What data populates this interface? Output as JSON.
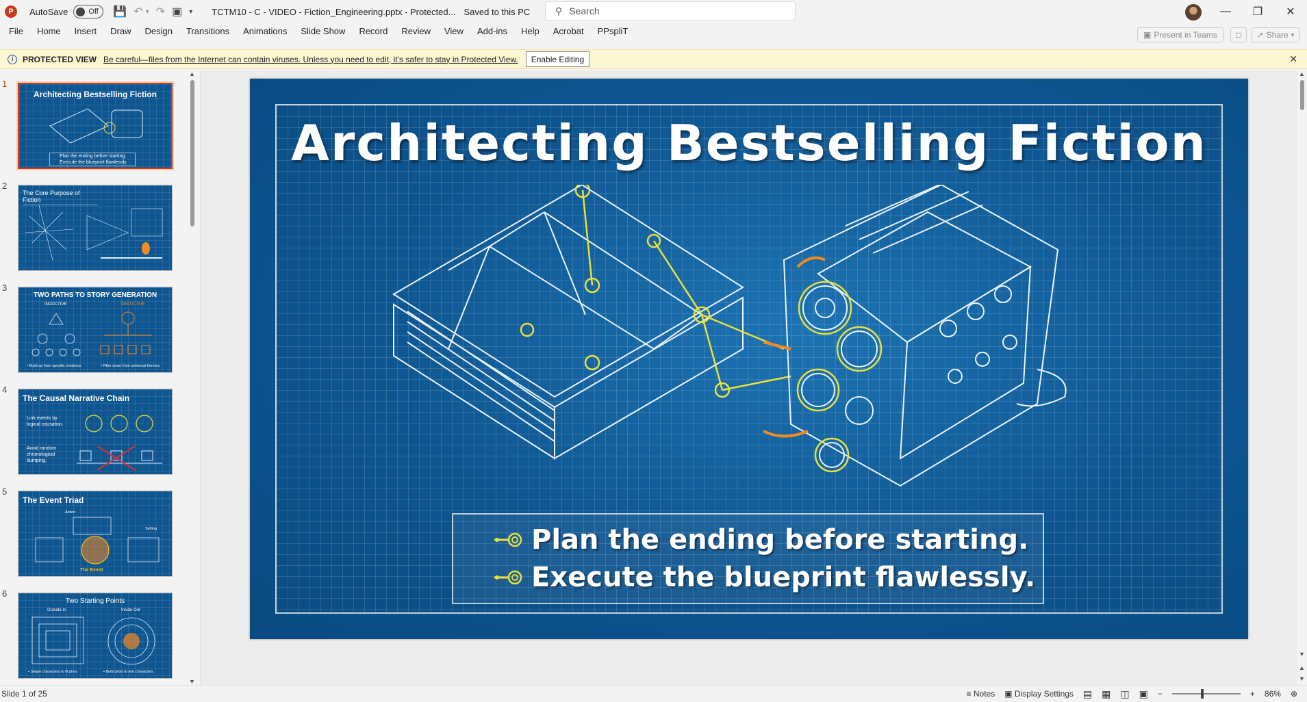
{
  "titlebar": {
    "logo": "P",
    "autosave_label": "AutoSave",
    "autosave_state": "Off",
    "doc_title": "TCTM10 - C - VIDEO - Fiction_Engineering.pptx  -  Protected...",
    "saved_status": "Saved to this PC",
    "search_placeholder": "Search"
  },
  "ribbon": {
    "tabs": [
      "File",
      "Home",
      "Insert",
      "Draw",
      "Design",
      "Transitions",
      "Animations",
      "Slide Show",
      "Record",
      "Review",
      "View",
      "Add-ins",
      "Help",
      "Acrobat",
      "PPspliT"
    ],
    "present_label": "Present in Teams",
    "share_label": "Share"
  },
  "protected_view": {
    "label": "PROTECTED VIEW",
    "message": "Be careful—files from the Internet can contain viruses. Unless you need to edit, it's safer to stay in Protected View.",
    "enable_button": "Enable Editing"
  },
  "thumbnails": [
    {
      "num": "1",
      "title": "Architecting Bestselling Fiction",
      "line1": "Plan the ending before starting.",
      "line2": "Execute the blueprint flawlessly."
    },
    {
      "num": "2",
      "title": "The Core Purpose of Fiction"
    },
    {
      "num": "3",
      "title": "TWO PATHS TO STORY GENERATION",
      "left": "INDUCTIVE",
      "right": "DEDUCTIVE",
      "foot_left": "• Build up from specific evidence.",
      "foot_right": "• Filter down from universal themes."
    },
    {
      "num": "4",
      "title": "The Causal Narrative Chain",
      "line1": "Link events by logical causation.",
      "line2": "Avoid random chronological dumping."
    },
    {
      "num": "5",
      "title": "The Event Triad",
      "a": "Action",
      "b": "Setting",
      "c": "The Event"
    },
    {
      "num": "6",
      "title": "Two Starting Points",
      "left": "Outside-In",
      "right": "Inside-Out",
      "foot_left": "• Shape characters to fit plots.",
      "foot_right": "• Build plots to test characters."
    }
  ],
  "slide": {
    "title": "Architecting Bestselling Fiction",
    "bullets": [
      "Plan the ending before starting.",
      "Execute the blueprint flawlessly."
    ]
  },
  "status": {
    "slide_count": "Slide 1 of 25",
    "notes": "Notes",
    "display_settings": "Display Settings",
    "zoom": "86%"
  },
  "colors": {
    "accent": "#c43e1c",
    "slide_blue": "#0f5a96",
    "highlight_yellow": "#e8e23a",
    "highlight_orange": "#f5891f"
  }
}
